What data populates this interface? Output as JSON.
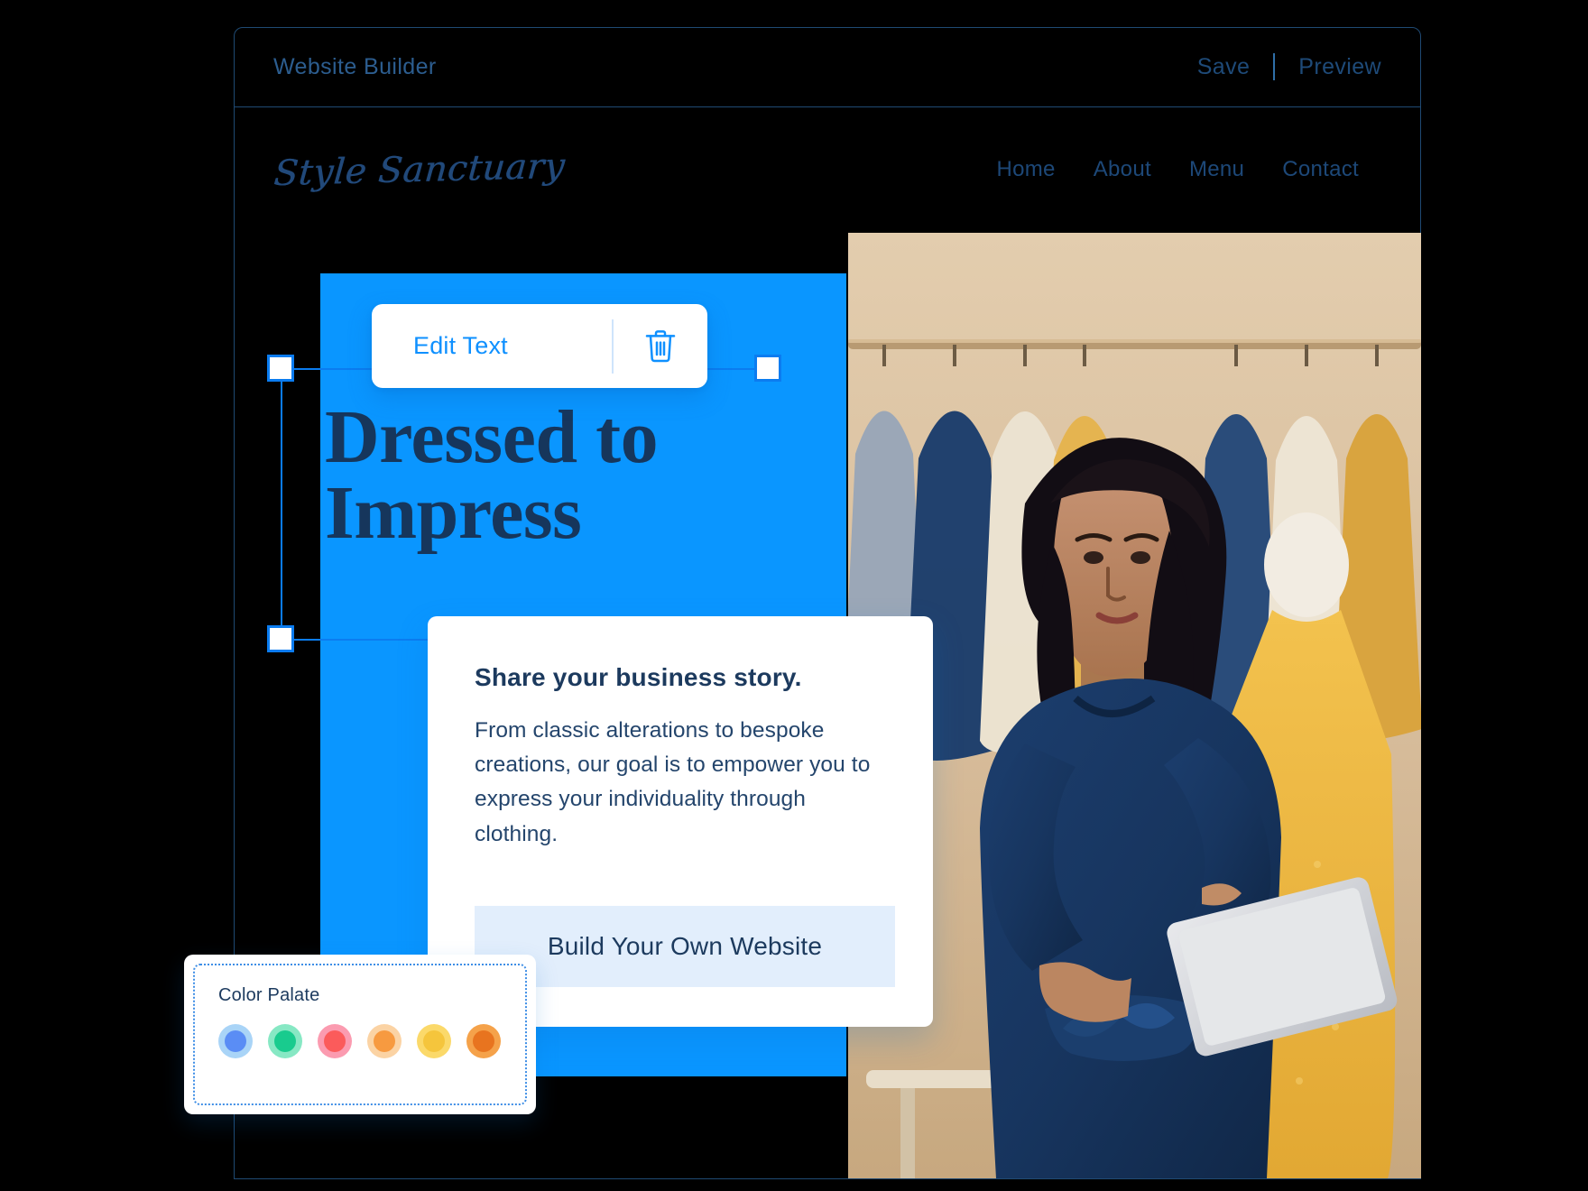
{
  "builder": {
    "app_title": "Website Builder",
    "actions": [
      {
        "label": "Save",
        "name": "save"
      },
      {
        "label": "Preview",
        "name": "preview"
      }
    ]
  },
  "site": {
    "brand": "Style Sanctuary",
    "nav": [
      {
        "label": "Home"
      },
      {
        "label": "About"
      },
      {
        "label": "Menu"
      },
      {
        "label": "Contact"
      }
    ],
    "hero": {
      "heading_line1": "Dressed to",
      "heading_line2": "Impress",
      "block_color": "#0a96ff",
      "heading_color": "#16365c"
    },
    "story": {
      "title": "Share your business story.",
      "body": "From classic alterations to bespoke creations, our goal is to empower you to express your individuality through clothing.",
      "cta_label": "Build Your Own Website"
    }
  },
  "edit_toolbar": {
    "label": "Edit Text",
    "delete_icon": "trash-icon"
  },
  "palette": {
    "title": "Color Palate",
    "swatches": [
      {
        "ring": "#a9d4f7",
        "core": "#5a8df5"
      },
      {
        "ring": "#87e8c4",
        "core": "#19cb8e"
      },
      {
        "ring": "#fb9bb0",
        "core": "#fb5b5b"
      },
      {
        "ring": "#fbd3a4",
        "core": "#f79a40"
      },
      {
        "ring": "#fbd96a",
        "core": "#f5c53c"
      },
      {
        "ring": "#f5a24a",
        "core": "#e8741f"
      }
    ]
  },
  "selection": {
    "handle_color": "#0b7cf0",
    "handle_fill": "#ffffff"
  }
}
